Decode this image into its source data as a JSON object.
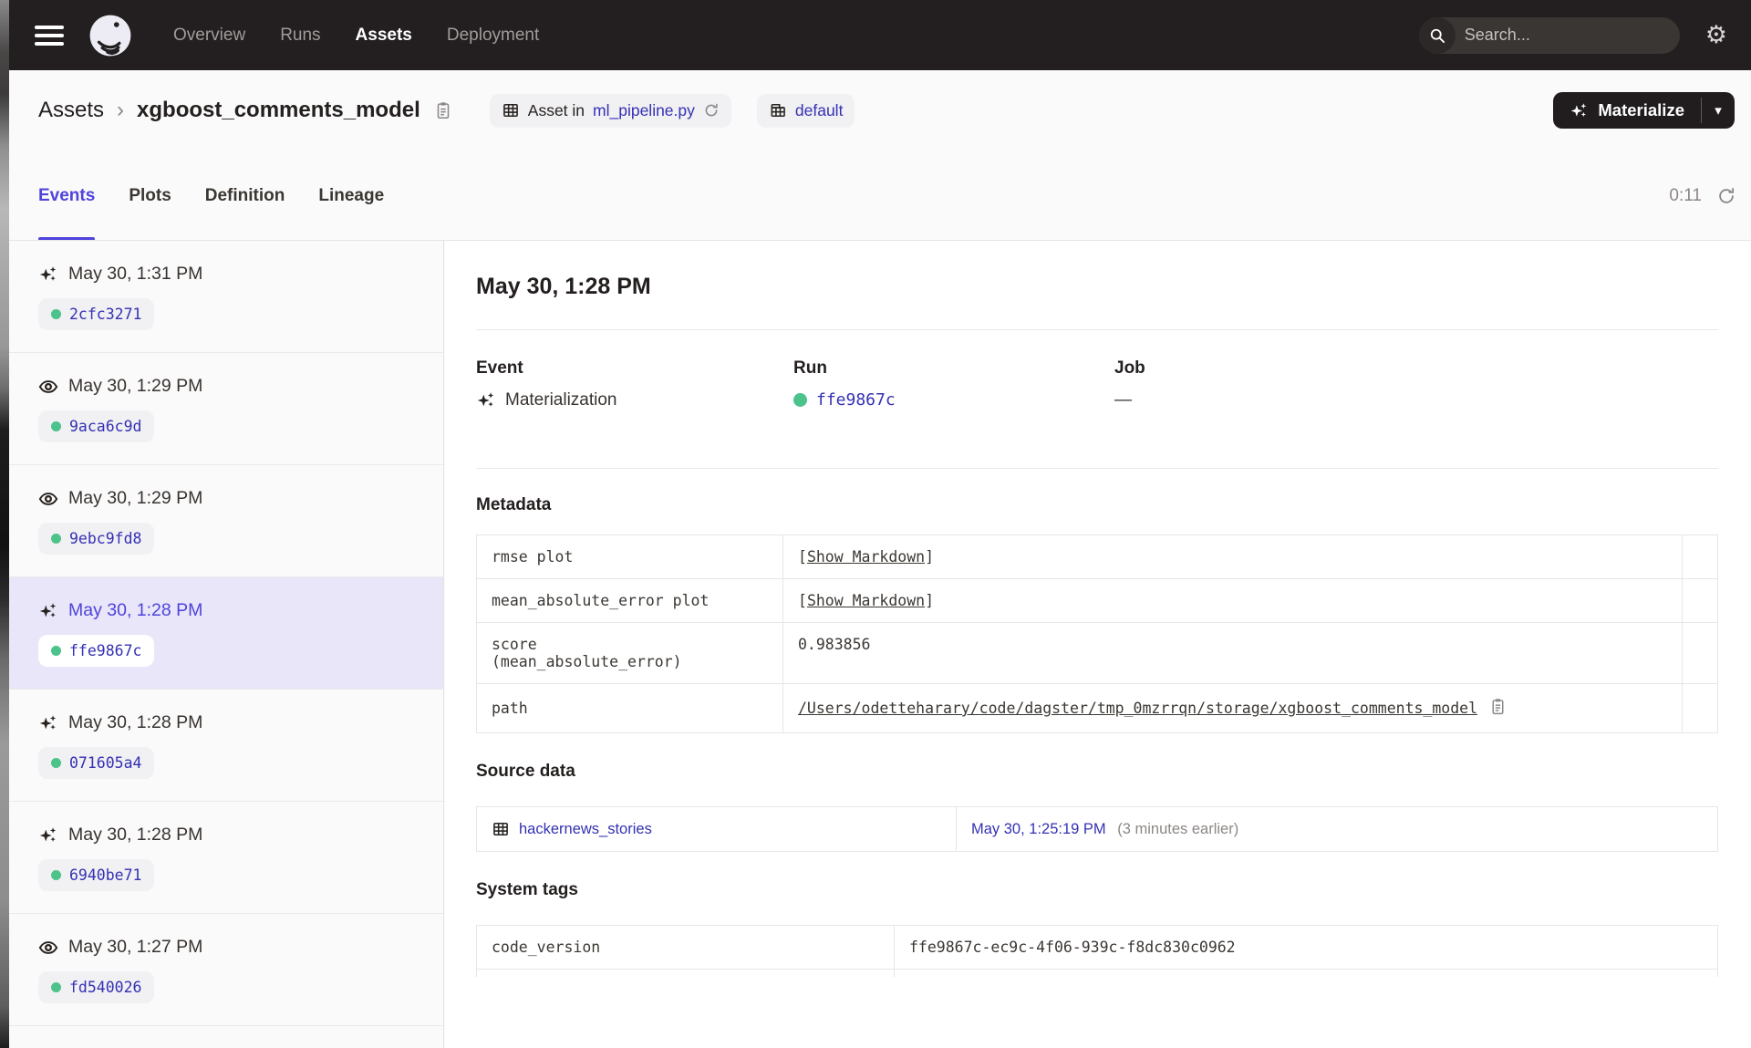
{
  "colors": {
    "accent": "#4f43dd",
    "link": "#3431b4",
    "green": "#4cc38a",
    "nav_bg": "#231f20",
    "selected_bg": "#e8e6f8"
  },
  "nav": {
    "items": [
      {
        "label": "Overview",
        "active": false
      },
      {
        "label": "Runs",
        "active": false
      },
      {
        "label": "Assets",
        "active": true
      },
      {
        "label": "Deployment",
        "active": false
      }
    ],
    "search_placeholder": "Search...",
    "search_shortcut": "/"
  },
  "breadcrumb": {
    "root": "Assets",
    "separator": "›",
    "asset_name": "xgboost_comments_model"
  },
  "asset_badge": {
    "prefix": "Asset in",
    "file": "ml_pipeline.py"
  },
  "repo_badge": {
    "label": "default"
  },
  "materialize": {
    "label": "Materialize"
  },
  "tabs": [
    {
      "label": "Events",
      "active": true
    },
    {
      "label": "Plots",
      "active": false
    },
    {
      "label": "Definition",
      "active": false
    },
    {
      "label": "Lineage",
      "active": false
    }
  ],
  "refresh_timer": "0:11",
  "sidebar": {
    "events": [
      {
        "type": "materialization",
        "timestamp": "May 30, 1:31 PM",
        "run_id": "2cfc3271",
        "selected": false
      },
      {
        "type": "observation",
        "timestamp": "May 30, 1:29 PM",
        "run_id": "9aca6c9d",
        "selected": false
      },
      {
        "type": "observation",
        "timestamp": "May 30, 1:29 PM",
        "run_id": "9ebc9fd8",
        "selected": false
      },
      {
        "type": "materialization",
        "timestamp": "May 30, 1:28 PM",
        "run_id": "ffe9867c",
        "selected": true
      },
      {
        "type": "materialization",
        "timestamp": "May 30, 1:28 PM",
        "run_id": "071605a4",
        "selected": false
      },
      {
        "type": "materialization",
        "timestamp": "May 30, 1:28 PM",
        "run_id": "6940be71",
        "selected": false
      },
      {
        "type": "observation",
        "timestamp": "May 30, 1:27 PM",
        "run_id": "fd540026",
        "selected": false
      }
    ]
  },
  "detail": {
    "title": "May 30, 1:28 PM",
    "event_header": "Event",
    "run_header": "Run",
    "job_header": "Job",
    "event_value": "Materialization",
    "run_value": "ffe9867c",
    "job_value": "—",
    "metadata": {
      "title": "Metadata",
      "bracket_open": "[",
      "bracket_close": "]",
      "rows": [
        {
          "key": "rmse plot",
          "link": "Show Markdown"
        },
        {
          "key": "mean_absolute_error plot",
          "link": "Show Markdown"
        },
        {
          "key": "score\n(mean_absolute_error)",
          "value": "0.983856"
        },
        {
          "key": "path",
          "value": "/Users/odetteharary/code/dagster/tmp_0mzrrqn/storage/xgboost_comments_model"
        }
      ]
    },
    "source_data": {
      "title": "Source data",
      "asset": "hackernews_stories",
      "timestamp": "May 30, 1:25:19 PM",
      "relative": "(3 minutes earlier)"
    },
    "system_tags": {
      "title": "System tags",
      "rows": [
        {
          "key": "code_version",
          "value": "ffe9867c-ec9c-4f06-939c-f8dc830c0962"
        }
      ]
    }
  }
}
